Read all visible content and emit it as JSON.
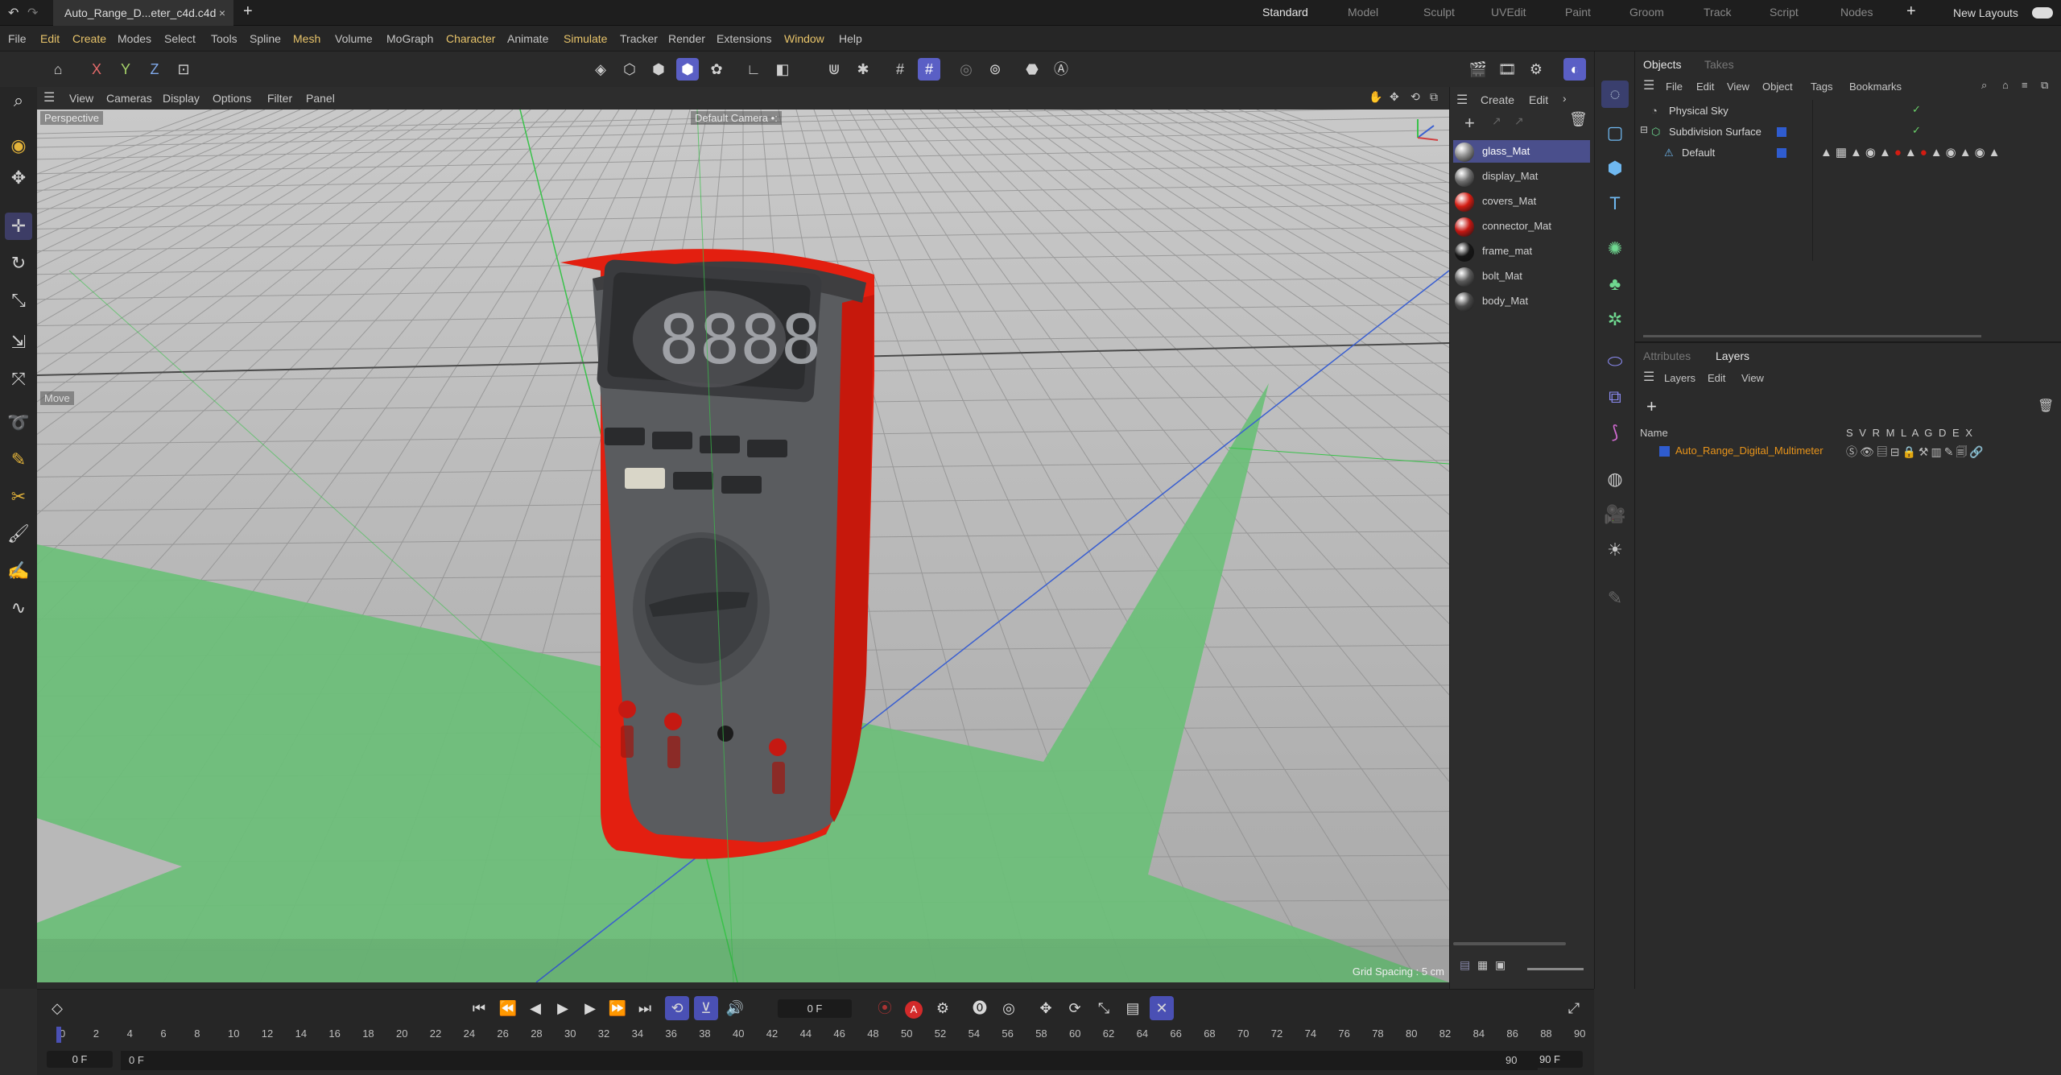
{
  "titlebar": {
    "doc_title": "Auto_Range_D...eter_c4d.c4d",
    "close": "×",
    "new_tab": "+",
    "layouts": [
      "Standard",
      "Model",
      "Sculpt",
      "UVEdit",
      "Paint",
      "Groom",
      "Track",
      "Script",
      "Nodes"
    ],
    "add": "+",
    "new_layouts": "New Layouts"
  },
  "menubar": {
    "items": [
      "File",
      "Edit",
      "Create",
      "Modes",
      "Select",
      "Tools",
      "Spline",
      "Mesh",
      "Volume",
      "MoGraph",
      "Character",
      "Animate",
      "Simulate",
      "Tracker",
      "Render",
      "Extensions",
      "Window",
      "Help"
    ]
  },
  "toolbar": {
    "axes": [
      "X",
      "Y",
      "Z"
    ]
  },
  "viewport": {
    "menu": [
      "View",
      "Cameras",
      "Display",
      "Options",
      "Filter",
      "Panel"
    ],
    "view_name": "Perspective",
    "camera": "Default Camera",
    "camera_suffix": "•:",
    "hud_tool": "Move",
    "grid_spacing": "Grid Spacing : 5 cm",
    "display_digits": "8888",
    "colors": {
      "floor_highlight": "#6bbf78",
      "floor": "#b4b4b4",
      "body": "#e31f10",
      "case": "#5a5c5f"
    }
  },
  "materials": {
    "menu": [
      "Create",
      "Edit"
    ],
    "items": [
      {
        "name": "glass_Mat",
        "color": "#8a8a8a",
        "selected": true
      },
      {
        "name": "display_Mat",
        "color": "#6e6e6e"
      },
      {
        "name": "covers_Mat",
        "color": "#d31c12"
      },
      {
        "name": "connector_Mat",
        "color": "#c41712"
      },
      {
        "name": "frame_mat",
        "color": "#161616"
      },
      {
        "name": "bolt_Mat",
        "color": "#5a5a5a"
      },
      {
        "name": "body_Mat",
        "color": "#4a4a4a"
      }
    ]
  },
  "objects": {
    "tabs": [
      "Objects",
      "Takes"
    ],
    "menu": [
      "File",
      "Edit",
      "View",
      "Object",
      "Tags",
      "Bookmarks"
    ],
    "rows": [
      {
        "name": "Physical Sky",
        "indent": 0
      },
      {
        "name": "Subdivision Surface",
        "indent": 0
      },
      {
        "name": "Default",
        "indent": 1
      }
    ]
  },
  "layers": {
    "tabs": [
      "Attributes",
      "Layers"
    ],
    "menu": [
      "Layers",
      "Edit",
      "View"
    ],
    "col_name": "Name",
    "col_flags": "S V R M L A G D E X",
    "layer_name": "Auto_Range_Digital_Multimeter"
  },
  "timeline": {
    "current_frame": "0 F",
    "ticks": [
      "0",
      "2",
      "4",
      "6",
      "8",
      "10",
      "12",
      "14",
      "16",
      "18",
      "20",
      "22",
      "24",
      "26",
      "28",
      "30",
      "32",
      "34",
      "36",
      "38",
      "40",
      "42",
      "44",
      "46",
      "48",
      "50",
      "52",
      "54",
      "56",
      "58",
      "60",
      "62",
      "64",
      "66",
      "68",
      "70",
      "72",
      "74",
      "76",
      "78",
      "80",
      "82",
      "84",
      "86",
      "88",
      "90"
    ],
    "start": "0 F",
    "start2": "0 F",
    "end": "90 F",
    "end2": "90 F",
    "rec": "A"
  }
}
